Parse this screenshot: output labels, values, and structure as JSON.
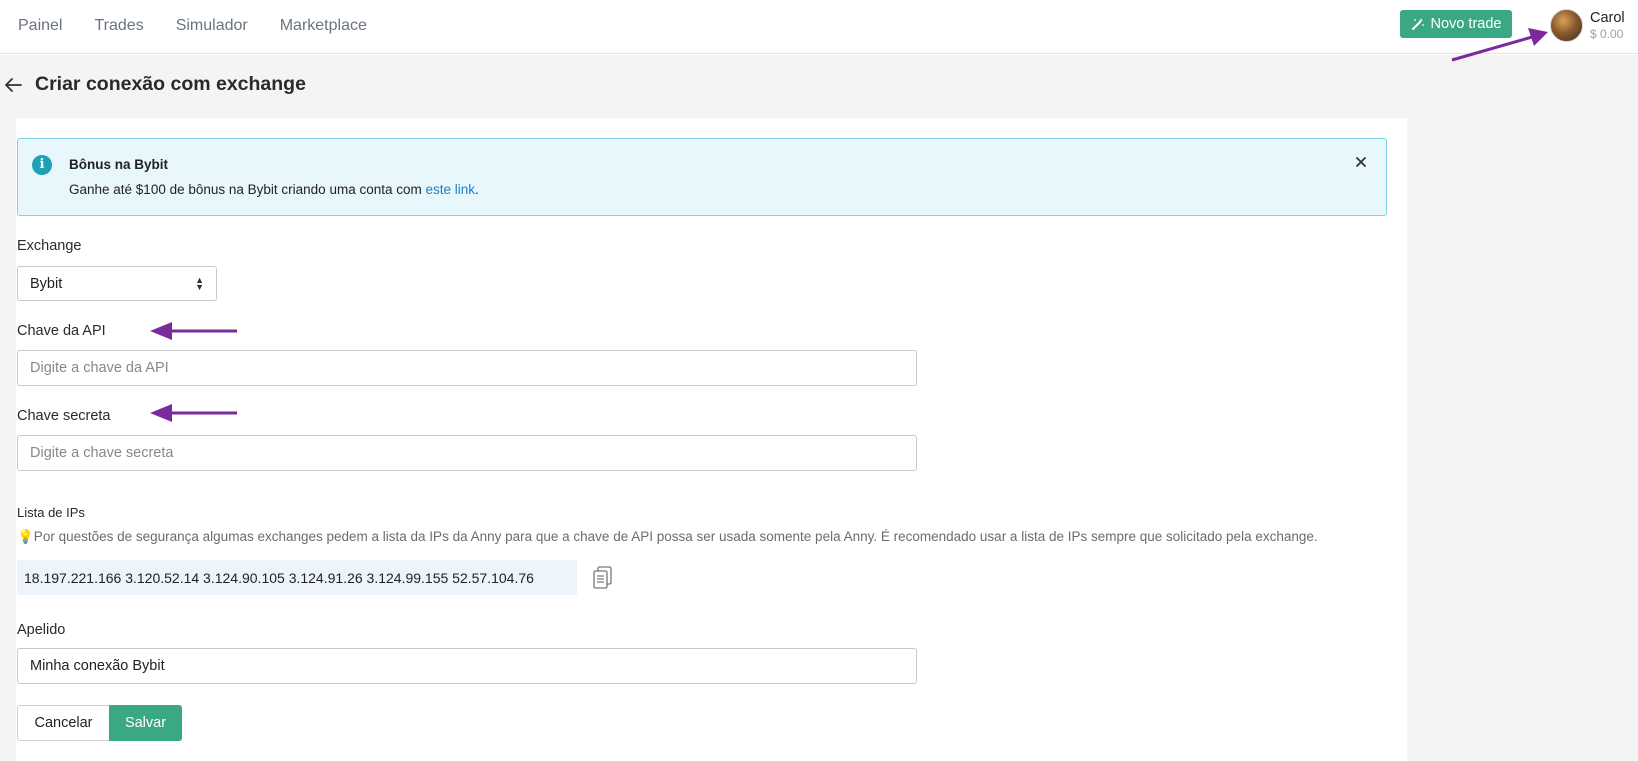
{
  "nav": {
    "items": [
      "Painel",
      "Trades",
      "Simulador",
      "Marketplace"
    ]
  },
  "header": {
    "new_trade_label": "Novo trade",
    "user_name": "Carol",
    "user_balance": "$ 0.00"
  },
  "page": {
    "title": "Criar conexão com exchange"
  },
  "alert": {
    "title": "Bônus na Bybit",
    "text_before": "Ganhe até $100 de bônus na Bybit criando uma conta com ",
    "link_text": "este link",
    "text_after": "."
  },
  "form": {
    "exchange_label": "Exchange",
    "exchange_value": "Bybit",
    "api_key_label": "Chave da API",
    "api_key_placeholder": "Digite a chave da API",
    "secret_label": "Chave secreta",
    "secret_placeholder": "Digite a chave secreta",
    "ips_label": "Lista de IPs",
    "ips_note": "💡Por questões de segurança algumas exchanges pedem a lista da IPs da Anny para que a chave de API possa ser usada somente pela Anny. É recomendado usar a lista de IPs sempre que solicitado pela exchange.",
    "ips_value": "18.197.221.166 3.120.52.14 3.124.90.105 3.124.91.26 3.124.99.155 52.57.104.76",
    "nickname_label": "Apelido",
    "nickname_value": "Minha conexão Bybit",
    "cancel_label": "Cancelar",
    "save_label": "Salvar"
  },
  "colors": {
    "primary": "#3aa885",
    "alert_bg": "#e8f7fb",
    "alert_border": "#7fd2e0",
    "link": "#1a7fd1",
    "annotation_arrow": "#7b2a9e"
  }
}
